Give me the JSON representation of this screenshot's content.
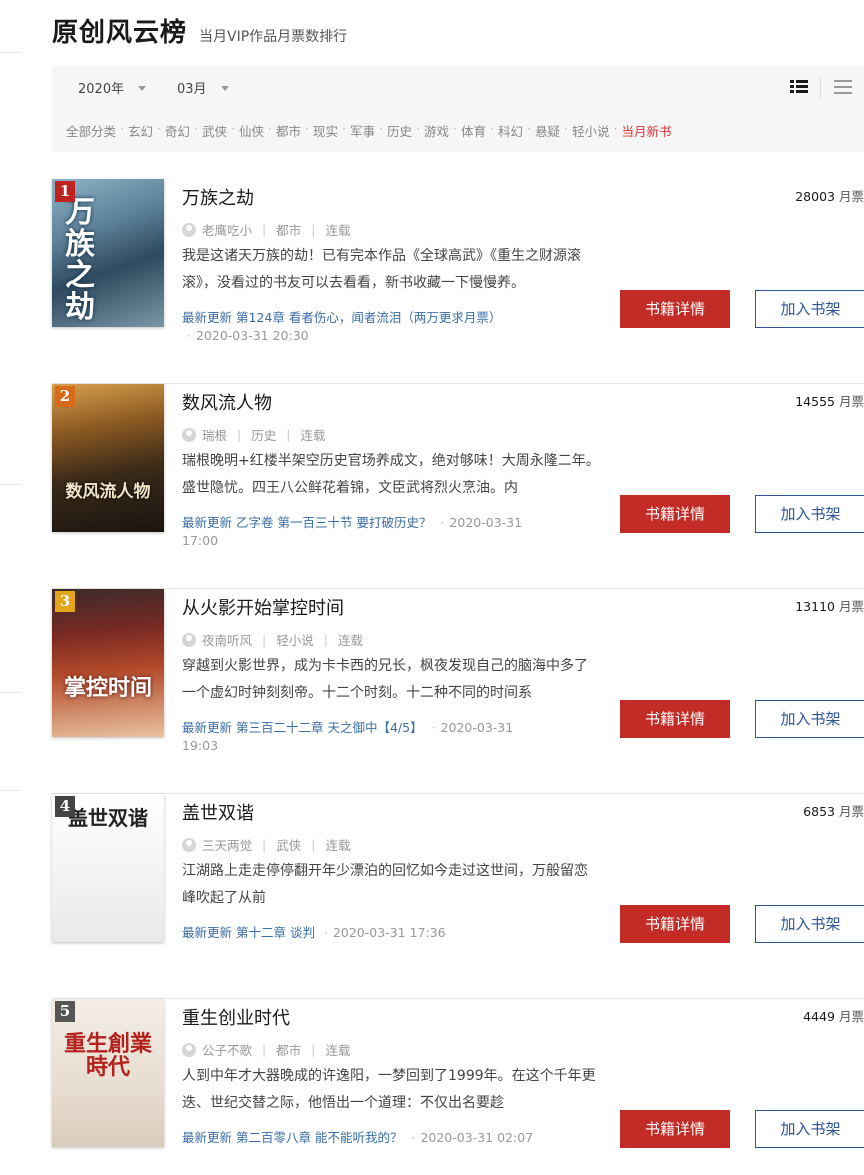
{
  "header": {
    "title": "原创风云榜",
    "subtitle": "当月VIP作品月票数排行"
  },
  "filter": {
    "year": "2020年",
    "month": "03月",
    "categories": [
      "全部分类",
      "玄幻",
      "奇幻",
      "武侠",
      "仙侠",
      "都市",
      "现实",
      "军事",
      "历史",
      "游戏",
      "体育",
      "科幻",
      "悬疑",
      "轻小说",
      "当月新书"
    ],
    "active_category": "当月新书"
  },
  "labels": {
    "latest": "最新更新",
    "votes_unit": "月票",
    "detail_button": "书籍详情",
    "shelf_button": "加入书架"
  },
  "colors": {
    "accent_red": "#c22b26",
    "link_blue": "#3a6ea5",
    "shelf_blue": "#2b5597"
  },
  "books": [
    {
      "rank": "1",
      "title": "万族之劫",
      "author": "老鹰吃小",
      "category": "都市",
      "status": "连载",
      "intro": "我是这诸天万族的劫！已有完本作品《全球高武》《重生之财源滚滚》，没看过的书友可以去看看，新书收藏一下慢慢养。",
      "chapter": "第124章 看者伤心，闻者流泪（两万更求月票）",
      "time": "2020-03-31 20:30",
      "votes": "28003",
      "cover_text": "万族之劫"
    },
    {
      "rank": "2",
      "title": "数风流人物",
      "author": "瑞根",
      "category": "历史",
      "status": "连载",
      "intro": "瑞根晚明+红楼半架空历史官场养成文，绝对够味！大周永隆二年。盛世隐忧。四王八公鲜花着锦，文臣武将烈火烹油。内",
      "chapter": "乙字卷 第一百三十节 要打破历史？",
      "time": "2020-03-31 17:00",
      "votes": "14555",
      "cover_text": "数风流人物"
    },
    {
      "rank": "3",
      "title": "从火影开始掌控时间",
      "author": "夜南听风",
      "category": "轻小说",
      "status": "连载",
      "intro": "穿越到火影世界，成为卡卡西的兄长，枫夜发现自己的脑海中多了一个虚幻时钟刻刻帝。十二个时刻。十二种不同的时间系",
      "chapter": "第三百二十二章 天之御中【4/5】",
      "time": "2020-03-31 19:03",
      "votes": "13110",
      "cover_text": "掌控时间"
    },
    {
      "rank": "4",
      "title": "盖世双谐",
      "author": "三天两觉",
      "category": "武侠",
      "status": "连载",
      "intro": "江湖路上走走停停翻开年少漂泊的回忆如今走过这世间，万般留恋峰吹起了从前",
      "chapter": "第十二章 谈判",
      "time": "2020-03-31 17:36",
      "votes": "6853",
      "cover_text": "盖世双谐"
    },
    {
      "rank": "5",
      "title": "重生创业时代",
      "author": "公子不歌",
      "category": "都市",
      "status": "连载",
      "intro": "人到中年才大器晚成的许逸阳，一梦回到了1999年。在这个千年更迭、世纪交替之际，他悟出一个道理：不仅出名要趁",
      "chapter": "第二百零八章 能不能听我的？",
      "time": "2020-03-31 02:07",
      "votes": "4449",
      "cover_text": "重生創業時代"
    }
  ]
}
